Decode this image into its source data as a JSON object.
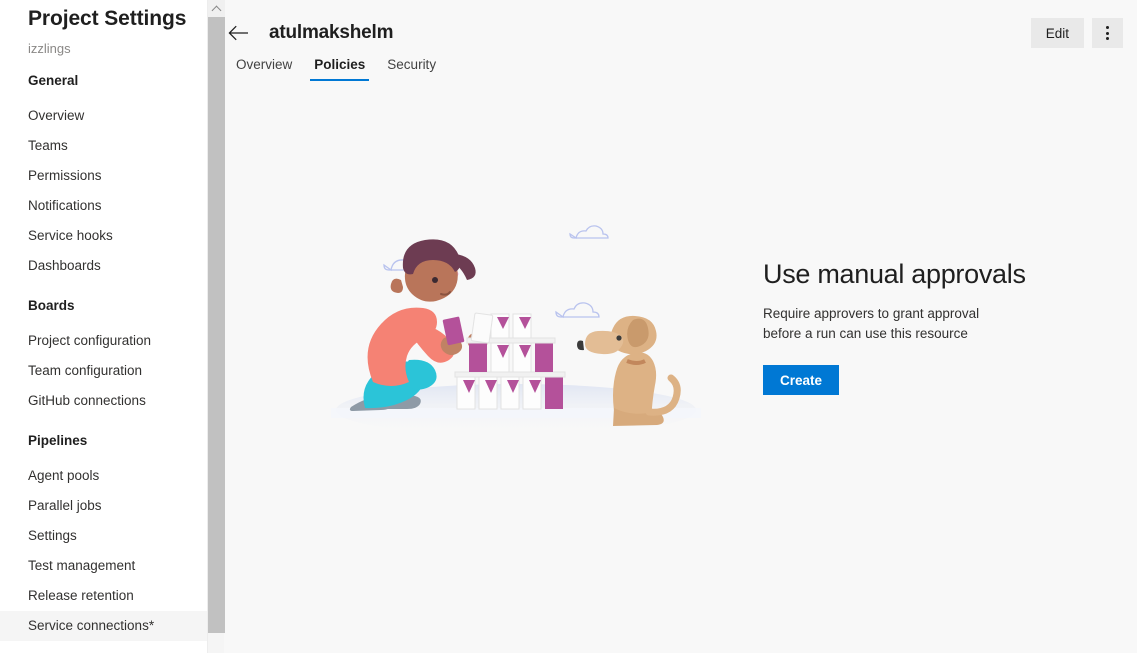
{
  "sidebar": {
    "title": "Project Settings",
    "project_name": "izzlings",
    "sections": [
      {
        "header": "General",
        "items": [
          {
            "label": "Overview",
            "selected": false
          },
          {
            "label": "Teams",
            "selected": false
          },
          {
            "label": "Permissions",
            "selected": false
          },
          {
            "label": "Notifications",
            "selected": false
          },
          {
            "label": "Service hooks",
            "selected": false
          },
          {
            "label": "Dashboards",
            "selected": false
          }
        ]
      },
      {
        "header": "Boards",
        "items": [
          {
            "label": "Project configuration",
            "selected": false
          },
          {
            "label": "Team configuration",
            "selected": false
          },
          {
            "label": "GitHub connections",
            "selected": false
          }
        ]
      },
      {
        "header": "Pipelines",
        "items": [
          {
            "label": "Agent pools",
            "selected": false
          },
          {
            "label": "Parallel jobs",
            "selected": false
          },
          {
            "label": "Settings",
            "selected": false
          },
          {
            "label": "Test management",
            "selected": false
          },
          {
            "label": "Release retention",
            "selected": false
          },
          {
            "label": "Service connections*",
            "selected": true
          }
        ]
      }
    ]
  },
  "header": {
    "back_icon": "back-arrow-icon",
    "title": "atulmakshelm",
    "tabs": [
      {
        "label": "Overview",
        "active": false
      },
      {
        "label": "Policies",
        "active": true
      },
      {
        "label": "Security",
        "active": false
      }
    ],
    "edit_label": "Edit",
    "more_icon": "more-vertical-icon"
  },
  "empty_state": {
    "illustration": "person-building-card-house-with-dog-illustration",
    "heading": "Use manual approvals",
    "description": "Require approvers to grant approval before a run can use this resource",
    "create_label": "Create"
  },
  "colors": {
    "accent": "#0078d4",
    "main_bg": "#f8f8f8",
    "sidebar_bg": "#ffffff",
    "selected_item_bg": "#f5f5f5",
    "button_bg": "#e9e9e9",
    "text_primary": "#1f1f1f",
    "text_muted": "#8a8886"
  }
}
